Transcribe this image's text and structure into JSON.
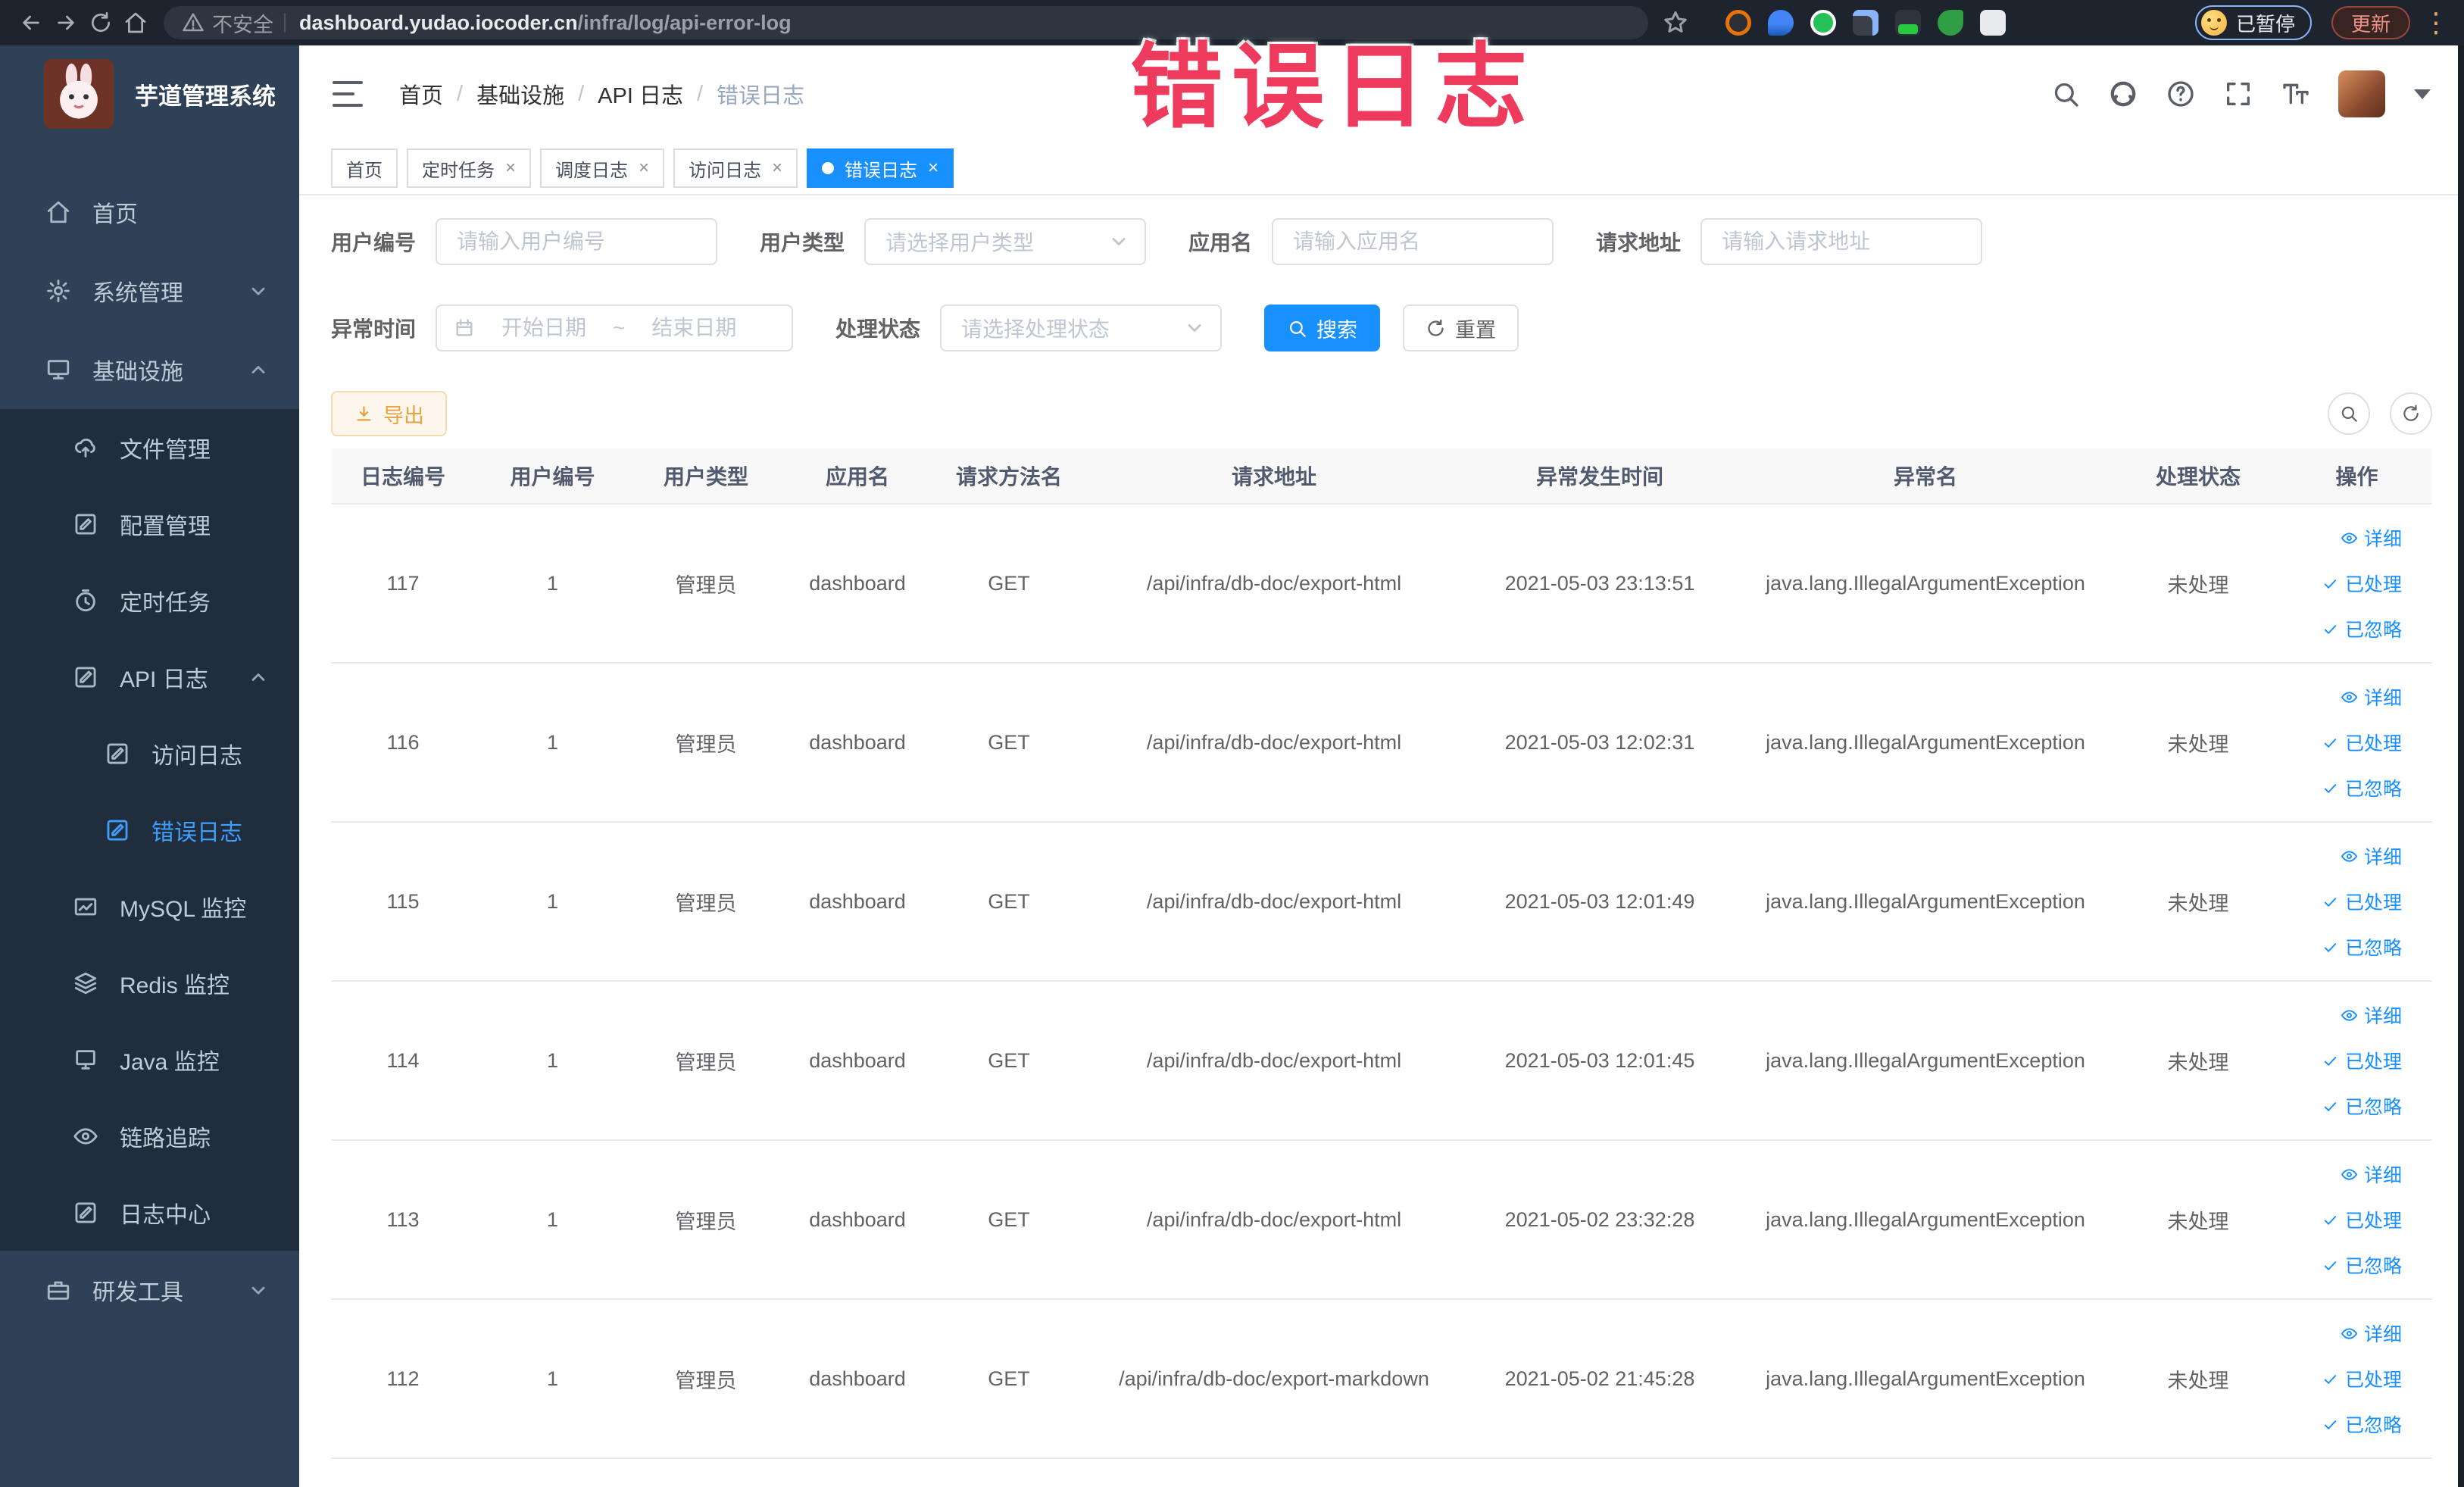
{
  "colors": {
    "accent": "#1890ff",
    "overlay_red": "#ee3a5d",
    "sidebar_bg": "#2e4156",
    "sidebar_submenu_bg": "#1f2d3d",
    "export_orange": "#e6a23c",
    "tab_active_bg": "#1890ff"
  },
  "browser": {
    "security_label": "不安全",
    "url_domain": "dashboard.yudao.iocoder.cn",
    "url_path": "/infra/log/api-error-log",
    "profile_chip_label": "已暂停",
    "update_button_label": "更新"
  },
  "overlay_title": "错误日志",
  "sidebar": {
    "logo_title": "芋道管理系统",
    "items": [
      {
        "name": "home",
        "label": "首页",
        "icon": "home",
        "level": 0,
        "sub": false
      },
      {
        "name": "system-management",
        "label": "系统管理",
        "icon": "gear",
        "level": 0,
        "sub": false,
        "chevron": "down"
      },
      {
        "name": "infrastructure",
        "label": "基础设施",
        "icon": "monitor",
        "level": 0,
        "sub": false,
        "chevron": "up"
      },
      {
        "name": "file-management",
        "label": "文件管理",
        "icon": "cloud-upload",
        "level": 1,
        "sub": true
      },
      {
        "name": "config-management",
        "label": "配置管理",
        "icon": "edit-square",
        "level": 1,
        "sub": true
      },
      {
        "name": "scheduled-tasks",
        "label": "定时任务",
        "icon": "timer",
        "level": 1,
        "sub": true
      },
      {
        "name": "api-log",
        "label": "API 日志",
        "icon": "log",
        "level": 1,
        "sub": true,
        "chevron": "up"
      },
      {
        "name": "access-log",
        "label": "访问日志",
        "icon": "log",
        "level": 2,
        "sub": true
      },
      {
        "name": "error-log",
        "label": "错误日志",
        "icon": "log",
        "level": 2,
        "sub": true,
        "active": true
      },
      {
        "name": "mysql-monitor",
        "label": "MySQL 监控",
        "icon": "chart",
        "level": 1,
        "sub": true
      },
      {
        "name": "redis-monitor",
        "label": "Redis 监控",
        "icon": "layers",
        "level": 1,
        "sub": true
      },
      {
        "name": "java-monitor",
        "label": "Java 监控",
        "icon": "screen",
        "level": 1,
        "sub": true
      },
      {
        "name": "trace",
        "label": "链路追踪",
        "icon": "eye",
        "level": 1,
        "sub": true
      },
      {
        "name": "log-center",
        "label": "日志中心",
        "icon": "log",
        "level": 1,
        "sub": true
      },
      {
        "name": "dev-tools",
        "label": "研发工具",
        "icon": "toolbox",
        "level": 0,
        "sub": false,
        "chevron": "down"
      }
    ]
  },
  "header": {
    "breadcrumb": [
      "首页",
      "基础设施",
      "API 日志",
      "错误日志"
    ]
  },
  "tabs": [
    {
      "name": "tab-home",
      "label": "首页",
      "closable": false,
      "active": false
    },
    {
      "name": "tab-scheduled-tasks",
      "label": "定时任务",
      "closable": true,
      "active": false
    },
    {
      "name": "tab-schedule-log",
      "label": "调度日志",
      "closable": true,
      "active": false
    },
    {
      "name": "tab-access-log",
      "label": "访问日志",
      "closable": true,
      "active": false
    },
    {
      "name": "tab-error-log",
      "label": "错误日志",
      "closable": true,
      "active": true
    }
  ],
  "filters": {
    "user_id": {
      "label": "用户编号",
      "placeholder": "请输入用户编号"
    },
    "user_type": {
      "label": "用户类型",
      "placeholder": "请选择用户类型"
    },
    "app_name": {
      "label": "应用名",
      "placeholder": "请输入应用名"
    },
    "request_url": {
      "label": "请求地址",
      "placeholder": "请输入请求地址"
    },
    "exception_time": {
      "label": "异常时间",
      "start_placeholder": "开始日期",
      "separator": "~",
      "end_placeholder": "结束日期"
    },
    "process_status": {
      "label": "处理状态",
      "placeholder": "请选择处理状态"
    },
    "search_button": "搜索",
    "reset_button": "重置"
  },
  "toolbar": {
    "export_button": "导出"
  },
  "table": {
    "headers": [
      "日志编号",
      "用户编号",
      "用户类型",
      "应用名",
      "请求方法名",
      "请求地址",
      "异常发生时间",
      "异常名",
      "处理状态",
      "操作"
    ],
    "row_actions": [
      {
        "name": "detail-link",
        "label": "详细",
        "icon": "eye"
      },
      {
        "name": "processed-link",
        "label": "已处理",
        "icon": "check"
      },
      {
        "name": "ignored-link",
        "label": "已忽略",
        "icon": "check"
      }
    ],
    "rows": [
      {
        "log_id": "117",
        "user_id": "1",
        "user_type": "管理员",
        "app_name": "dashboard",
        "method": "GET",
        "url": "/api/infra/db-doc/export-html",
        "time": "2021-05-03 23:13:51",
        "exception": "java.lang.IllegalArgumentException",
        "status": "未处理"
      },
      {
        "log_id": "116",
        "user_id": "1",
        "user_type": "管理员",
        "app_name": "dashboard",
        "method": "GET",
        "url": "/api/infra/db-doc/export-html",
        "time": "2021-05-03 12:02:31",
        "exception": "java.lang.IllegalArgumentException",
        "status": "未处理"
      },
      {
        "log_id": "115",
        "user_id": "1",
        "user_type": "管理员",
        "app_name": "dashboard",
        "method": "GET",
        "url": "/api/infra/db-doc/export-html",
        "time": "2021-05-03 12:01:49",
        "exception": "java.lang.IllegalArgumentException",
        "status": "未处理"
      },
      {
        "log_id": "114",
        "user_id": "1",
        "user_type": "管理员",
        "app_name": "dashboard",
        "method": "GET",
        "url": "/api/infra/db-doc/export-html",
        "time": "2021-05-03 12:01:45",
        "exception": "java.lang.IllegalArgumentException",
        "status": "未处理"
      },
      {
        "log_id": "113",
        "user_id": "1",
        "user_type": "管理员",
        "app_name": "dashboard",
        "method": "GET",
        "url": "/api/infra/db-doc/export-html",
        "time": "2021-05-02 23:32:28",
        "exception": "java.lang.IllegalArgumentException",
        "status": "未处理"
      },
      {
        "log_id": "112",
        "user_id": "1",
        "user_type": "管理员",
        "app_name": "dashboard",
        "method": "GET",
        "url": "/api/infra/db-doc/export-markdown",
        "time": "2021-05-02 21:45:28",
        "exception": "java.lang.IllegalArgumentException",
        "status": "未处理"
      }
    ]
  }
}
